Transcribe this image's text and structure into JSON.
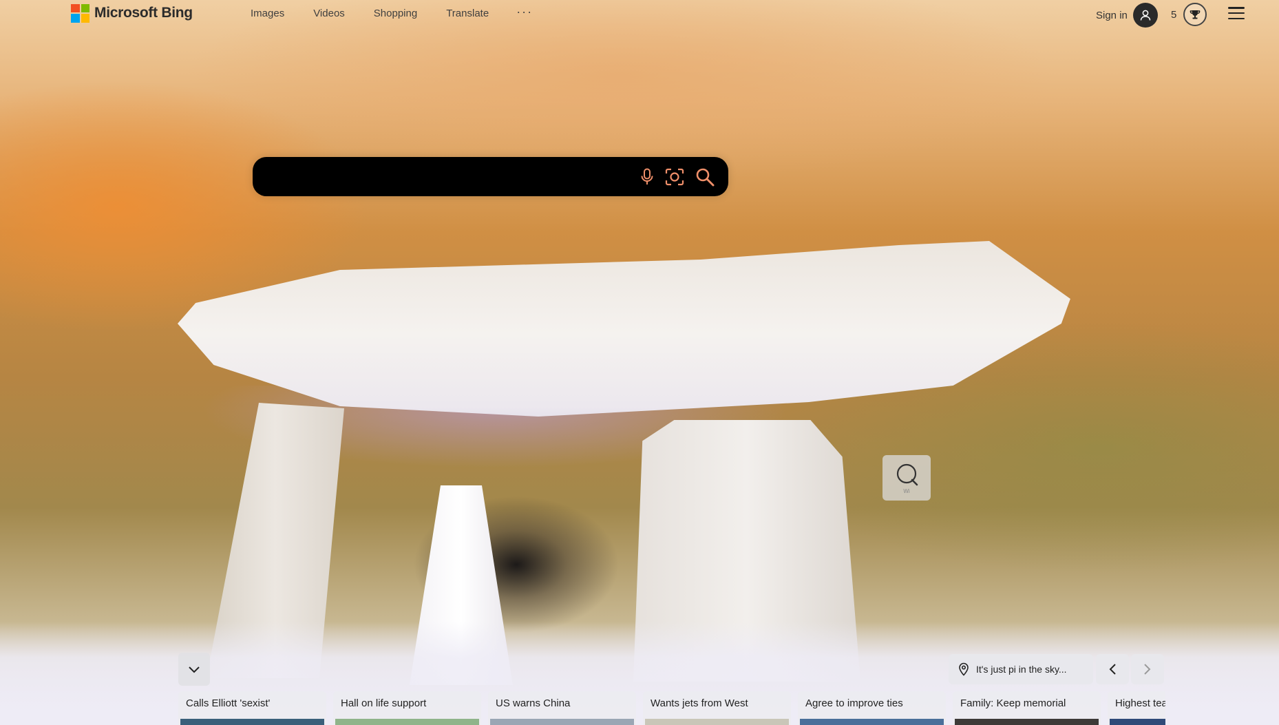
{
  "header": {
    "logo_text": "Microsoft Bing",
    "nav": {
      "images": "Images",
      "videos": "Videos",
      "shopping": "Shopping",
      "translate": "Translate",
      "more": "···"
    },
    "signin_label": "Sign in",
    "rewards_count": "5"
  },
  "search": {
    "value": "",
    "placeholder": ""
  },
  "hotspot": {
    "caption": "Wi"
  },
  "location": {
    "text": "It's just pi in the sky..."
  },
  "news": [
    {
      "title": "Calls Elliott 'sexist'",
      "thumb_color": "#3a5f7a"
    },
    {
      "title": "Hall on life support",
      "thumb_color": "#8fb48a"
    },
    {
      "title": "US warns China",
      "thumb_color": "#9aa6b4"
    },
    {
      "title": "Wants jets from West",
      "thumb_color": "#c9c6b8"
    },
    {
      "title": "Agree to improve ties",
      "thumb_color": "#4a6f9a"
    },
    {
      "title": "Family: Keep memorial",
      "thumb_color": "#3d3a38"
    },
    {
      "title": "Highest tea",
      "thumb_color": "#2f4a78"
    }
  ],
  "colors": {
    "search_bg": "#000000",
    "search_icon": "#ef8f6a",
    "logo_red": "#f25022",
    "logo_green": "#7fba00",
    "logo_blue": "#00a4ef",
    "logo_yellow": "#ffb900"
  },
  "icons": {
    "mic": "microphone-icon",
    "visual_search": "camera-scan-icon",
    "search": "magnifier-icon",
    "user": "user-icon",
    "rewards": "trophy-icon",
    "menu": "hamburger-icon",
    "collapse": "chevron-down-icon",
    "location": "map-pin-icon",
    "prev": "chevron-left-icon",
    "next": "chevron-right-icon",
    "hotspot": "search-bubble-icon"
  }
}
